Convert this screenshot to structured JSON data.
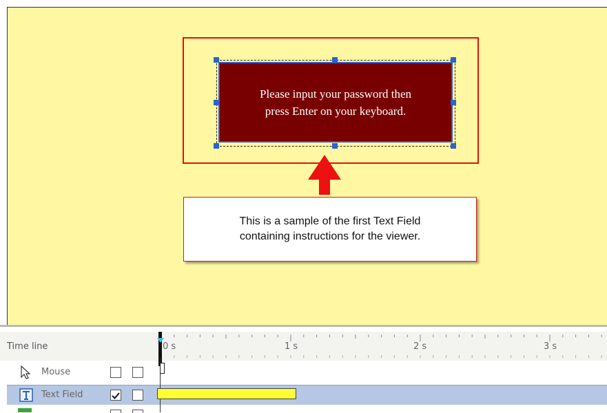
{
  "canvas": {
    "textfield_line1": "Please input your password then",
    "textfield_line2": "press Enter on your keyboard.",
    "callout_line1": "This is a sample of the first Text Field",
    "callout_line2": "containing instructions for the viewer."
  },
  "colors": {
    "canvas_bg": "#fff7a1",
    "textfield_bg": "#780000",
    "highlight_red": "#e01010",
    "selected_row": "#b6c7e3"
  },
  "timeline": {
    "title": "Time line",
    "ticks": [
      "0 s",
      "1 s",
      "2 s",
      "3 s"
    ],
    "rows": [
      {
        "label": "Mouse",
        "icon": "cursor-arrow-icon",
        "checked": false
      },
      {
        "label": "Text Field",
        "icon": "text-field-icon",
        "checked": true
      }
    ]
  }
}
